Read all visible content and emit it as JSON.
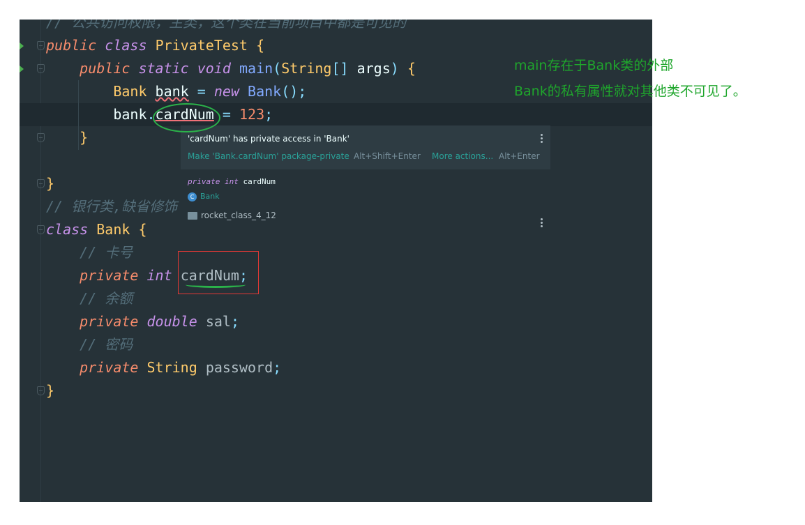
{
  "editor": {
    "lines": [
      {
        "comment": "// 公共访问权限，主类，这个类在当前项目中都是可见的"
      },
      {
        "kw1": "public",
        "kw2": "class",
        "name": "PrivateTest",
        "brace": "{"
      },
      {
        "kw1": "public",
        "kw2": "static",
        "kw3": "void",
        "fn": "main",
        "open": "(",
        "type": "String",
        "brackets": "[]",
        "param": "args",
        "close": ")",
        "brace": "{"
      },
      {
        "type": "Bank",
        "var": "bank",
        "eq": "=",
        "kw": "new",
        "ctor": "Bank",
        "parens": "()",
        "semi": ";"
      },
      {
        "obj": "bank",
        "dot": ".",
        "field": "cardNum",
        "eq": "=",
        "num": "123",
        "semi": ";"
      },
      {
        "brace": "}"
      },
      {
        "brace": "}"
      },
      {
        "comment": "// 银行类,缺省修饰"
      },
      {
        "kw": "class",
        "name": "Bank",
        "brace": "{"
      },
      {
        "comment": "// 卡号"
      },
      {
        "kw1": "private",
        "type": "int",
        "field": "cardNum",
        "semi": ";"
      },
      {
        "comment": "// 余额"
      },
      {
        "kw1": "private",
        "type": "double",
        "field": "sal",
        "semi": ";"
      },
      {
        "comment": "// 密码"
      },
      {
        "kw1": "private",
        "type": "String",
        "field": "password",
        "semi": ";"
      },
      {
        "brace": "}"
      }
    ]
  },
  "popup": {
    "error_message": "'cardNum' has private access in 'Bank'",
    "fix_action": "Make 'Bank.cardNum' package-private",
    "fix_shortcut": "Alt+Shift+Enter",
    "more_actions": "More actions...",
    "more_shortcut": "Alt+Enter",
    "decl_private": "private",
    "decl_type": "int",
    "decl_name": "cardNum",
    "class_name": "Bank",
    "module_name": "rocket_class_4_12"
  },
  "annotations": {
    "line1": "main存在于Bank类的外部",
    "line2": "Bank的私有属性就对其他类不可见了。"
  },
  "colors": {
    "editor_bg": "#263238",
    "annotation_green": "#1fa62c",
    "error_red": "#e53935",
    "link_teal": "#2aa198"
  }
}
